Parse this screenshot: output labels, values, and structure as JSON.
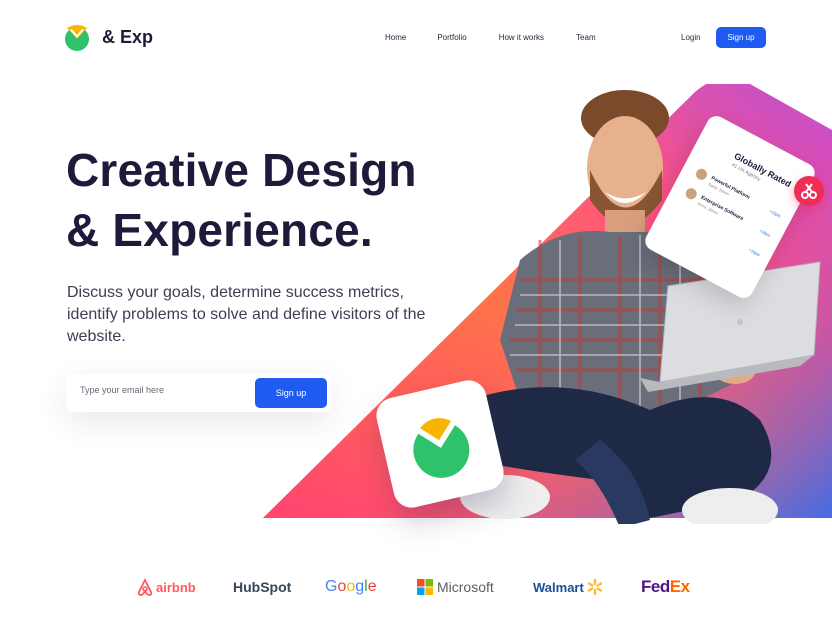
{
  "brand": {
    "name": "& Exp"
  },
  "nav": {
    "items": [
      "Home",
      "Portfolio",
      "How it works",
      "Team"
    ],
    "login_label": "Login",
    "signup_label": "Sign up"
  },
  "hero": {
    "title_line1": "Creative Design",
    "title_line2": "& Experience.",
    "subtitle": "Discuss your goals, determine success metrics, identify problems to solve and define visitors of the website.",
    "email_placeholder": "Type your email here",
    "signup_label": "Sign up"
  },
  "card": {
    "title": "Globally Rated",
    "subtitle": "#1 UX Agency",
    "rows": [
      {
        "name": "Powerful Platform",
        "meta": "Sakib, 10min",
        "tag": "+15pts"
      },
      {
        "name": "Enterprise Software",
        "meta": "Anna, 20min",
        "tag": "+18pts"
      },
      {
        "name": "",
        "meta": "",
        "tag": "+10pts"
      }
    ]
  },
  "brands": [
    "airbnb",
    "HubSpot",
    "Google",
    "Microsoft",
    "Walmart",
    "FedEx"
  ],
  "colors": {
    "accent": "#1f5bf0",
    "heading": "#1d1a3a",
    "logo_green": "#2ec36b",
    "logo_yellow": "#f7b500"
  }
}
